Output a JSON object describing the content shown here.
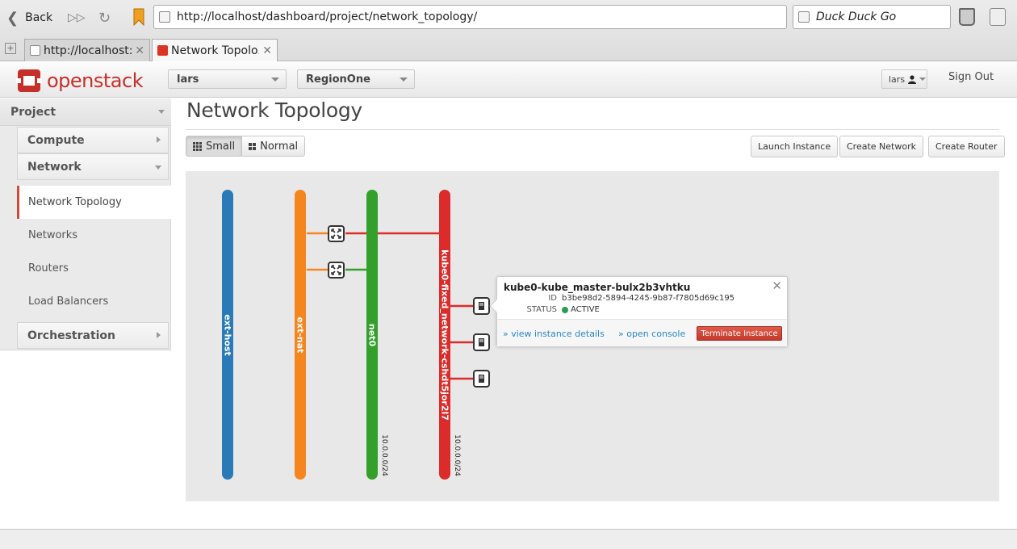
{
  "browser": {
    "back_label": "Back",
    "url": "http://localhost/dashboard/project/network_topology/",
    "search_engine": "Duck Duck Go",
    "tabs": [
      {
        "label": "http://localhost:...",
        "active": false
      },
      {
        "label": "Network Topolo...",
        "active": true
      }
    ]
  },
  "header": {
    "logo_text": "openstack",
    "project": "lars",
    "region": "RegionOne",
    "user": "lars",
    "sign_out": "Sign Out"
  },
  "sidebar": {
    "dashboard": "Project",
    "panels": {
      "compute": "Compute",
      "network": "Network",
      "orchestration": "Orchestration"
    },
    "items": [
      {
        "label": "Network Topology",
        "active": true
      },
      {
        "label": "Networks",
        "active": false
      },
      {
        "label": "Routers",
        "active": false
      },
      {
        "label": "Load Balancers",
        "active": false
      }
    ]
  },
  "main": {
    "title": "Network Topology",
    "toggle": {
      "small": "Small",
      "normal": "Normal",
      "selected": "small"
    },
    "actions": {
      "launch": "Launch Instance",
      "create_network": "Create Network",
      "create_router": "Create Router"
    }
  },
  "topology": {
    "networks": [
      {
        "name": "ext-host",
        "color": "#2a7ab8",
        "cidr": ""
      },
      {
        "name": "ext-nat",
        "color": "#f5861f",
        "cidr": ""
      },
      {
        "name": "net0",
        "color": "#33a02c",
        "cidr": "10.0.0.0/24"
      },
      {
        "name": "kube0-fixed_network-cshdt5jor2l7",
        "color": "#dc2b2b",
        "cidr": "10.0.0.0/24"
      }
    ],
    "router_icon": "router-icon",
    "instance_icon": "instance-icon"
  },
  "balloon": {
    "name": "kube0-kube_master-bulx2b3vhtku",
    "id_label": "ID",
    "id": "b3be98d2-5894-4245-9b87-f7805d69c195",
    "status_label": "STATUS",
    "status": "ACTIVE",
    "status_color": "#2a9a4f",
    "view_details": "» view instance details",
    "open_console": "» open console",
    "terminate": "Terminate Instance"
  },
  "colors": {
    "brand": "#c6302a",
    "link": "#2a86c8"
  }
}
